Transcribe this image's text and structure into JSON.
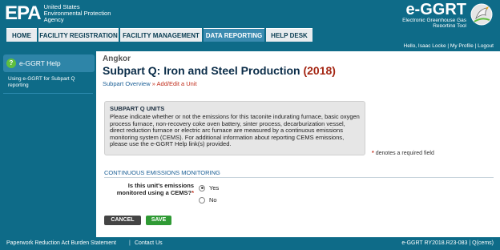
{
  "header": {
    "agency_mark": "EPA",
    "agency_name": [
      "United States",
      "Environmental Protection",
      "Agency"
    ],
    "app_title": "e-GGRT",
    "app_subtitle": [
      "Electronic Greenhouse Gas",
      "Reporting Tool"
    ],
    "bird_icon": "bird-logo-icon"
  },
  "nav": {
    "tabs": [
      "HOME",
      "FACILITY REGISTRATION",
      "FACILITY MANAGEMENT",
      "DATA REPORTING",
      "HELP DESK"
    ],
    "active_tab": "DATA REPORTING"
  },
  "userbar": {
    "text": "Hello, Isaac Locke | My Profile | Logout"
  },
  "sidebar": {
    "help_title": "e-GGRT Help",
    "help_icon": "help-question-icon",
    "link": "Using e-GGRT for Subpart Q reporting"
  },
  "main": {
    "facility": "Angkor",
    "title": "Subpart Q: Iron and Steel Production",
    "year": "(2018)",
    "breadcrumb_link": "Subpart Overview",
    "breadcrumb_sep": "»",
    "breadcrumb_current": "Add/Edit a Unit",
    "info_title": "SUBPART Q UNITS",
    "info_body": "Please indicate whether or not the emissions for this taconite indurating furnace, basic oxygen process furnace, non-recovery coke oven battery, sinter process, decarburization vessel, direct reduction furnace or electric arc furnace are measured by a continuous emissions monitoring system (CEMS). For additional information about reporting CEMS emissions, please use the e-GGRT Help link(s) provided.",
    "required_star": "*",
    "required_note": "denotes a required field",
    "section_title": "CONTINUOUS EMISSIONS MONITORING",
    "question": "Is this unit's emissions monitored using a CEMS?",
    "options": [
      "Yes",
      "No"
    ],
    "selected_option": "Yes",
    "cancel_label": "CANCEL",
    "save_label": "SAVE"
  },
  "footer": {
    "link1": "Paperwork Reduction Act Burden Statement",
    "separator": "|",
    "link2": "Contact Us",
    "version": "e-GGRT RY2018.R23-083 | Q(cems)"
  },
  "colors": {
    "brand_blue": "#0e6b88",
    "active_tab": "#3b8bb0",
    "year_red": "#a52714",
    "save_green": "#2f9a34",
    "cancel_gray": "#444444"
  }
}
